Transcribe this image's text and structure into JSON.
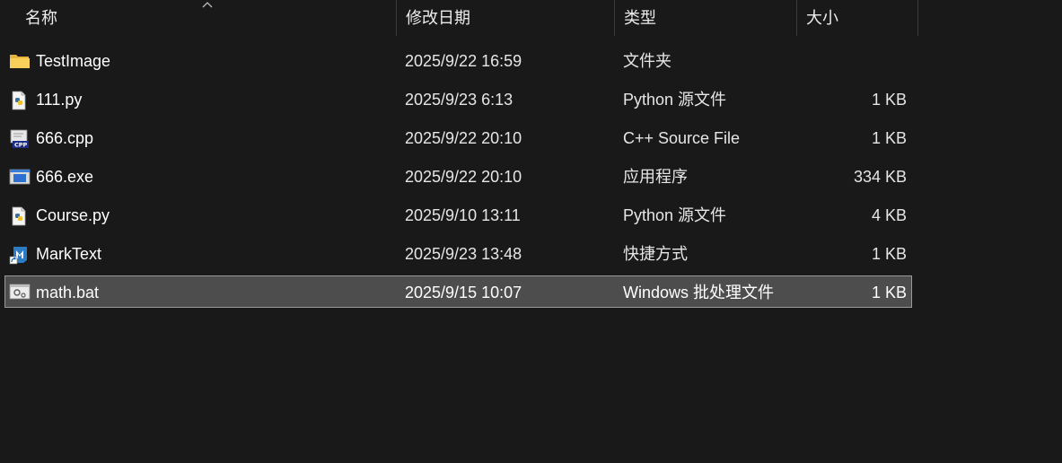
{
  "columns": {
    "name": "名称",
    "date": "修改日期",
    "type": "类型",
    "size": "大小"
  },
  "sort": {
    "column": "name",
    "direction": "ascending",
    "icon": "sort-up-chevron-icon"
  },
  "files": [
    {
      "name": "TestImage",
      "date": "2025/9/22 16:59",
      "type": "文件夹",
      "size": "",
      "icon": "folder-icon"
    },
    {
      "name": "111.py",
      "date": "2025/9/23 6:13",
      "type": "Python 源文件",
      "size": "1 KB",
      "icon": "python-file-icon"
    },
    {
      "name": "666.cpp",
      "date": "2025/9/22 20:10",
      "type": "C++ Source File",
      "size": "1 KB",
      "icon": "cpp-file-icon"
    },
    {
      "name": "666.exe",
      "date": "2025/9/22 20:10",
      "type": "应用程序",
      "size": "334 KB",
      "icon": "exe-file-icon"
    },
    {
      "name": "Course.py",
      "date": "2025/9/10 13:11",
      "type": "Python 源文件",
      "size": "4 KB",
      "icon": "python-file-icon"
    },
    {
      "name": "MarkText",
      "date": "2025/9/23 13:48",
      "type": "快捷方式",
      "size": "1 KB",
      "icon": "shortcut-icon"
    },
    {
      "name": "math.bat",
      "date": "2025/9/15 10:07",
      "type": "Windows 批处理文件",
      "size": "1 KB",
      "icon": "batch-file-icon",
      "selected": true
    }
  ],
  "colors": {
    "background": "#191919",
    "selection_fill": "#4d4d4d",
    "selection_border": "#9a9a9a",
    "folder": "#f4c542"
  }
}
